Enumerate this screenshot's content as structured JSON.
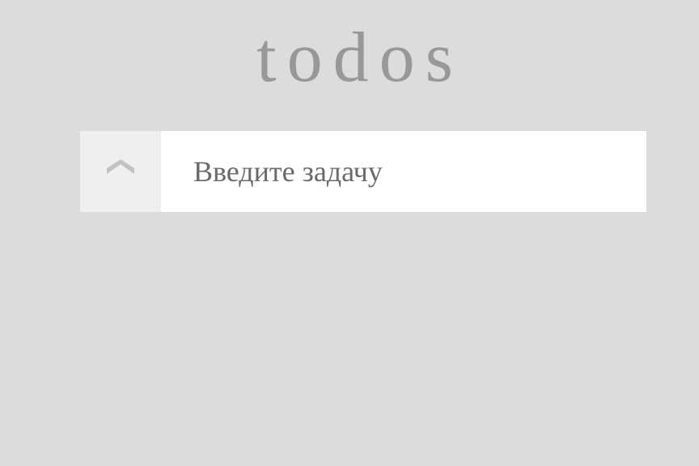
{
  "app": {
    "title": "todos"
  },
  "new_todo": {
    "placeholder": "Введите задачу",
    "value": ""
  },
  "toggle_all": {
    "icon": "chevron-up-icon"
  },
  "colors": {
    "background": "#dcdcdc",
    "title": "#989898",
    "input_background": "#ffffff",
    "toggle_background": "#efefef",
    "icon": "#c2c2c2",
    "placeholder": "#6a6a6a"
  }
}
